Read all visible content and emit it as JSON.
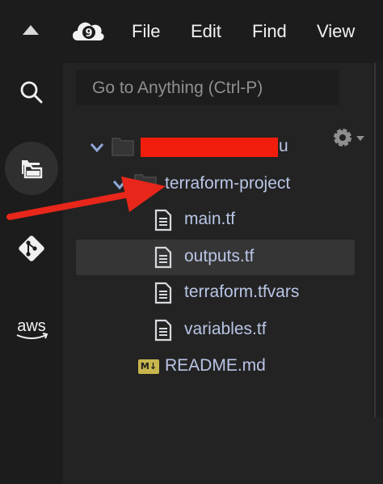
{
  "menubar": {
    "items": [
      "File",
      "Edit",
      "Find",
      "View"
    ],
    "logo_text": "9"
  },
  "search": {
    "placeholder": "Go to Anything (Ctrl-P)"
  },
  "rail": {
    "items": [
      {
        "icon": "search-icon"
      },
      {
        "icon": "folders-icon",
        "active": true
      },
      {
        "icon": "git-icon"
      },
      {
        "icon": "aws-icon",
        "label": "aws"
      }
    ]
  },
  "tree": {
    "root_suffix": "u",
    "root_redacted_mark": "ı",
    "folder": "terraform-project",
    "files": [
      "main.tf",
      "outputs.tf",
      "terraform.tfvars",
      "variables.tf"
    ],
    "selected": "outputs.tf",
    "readme": "README.md",
    "readme_badge": "M↓"
  },
  "colors": {
    "annotation": "#e8261a",
    "text": "#b9c5e6",
    "background": "#232323"
  }
}
